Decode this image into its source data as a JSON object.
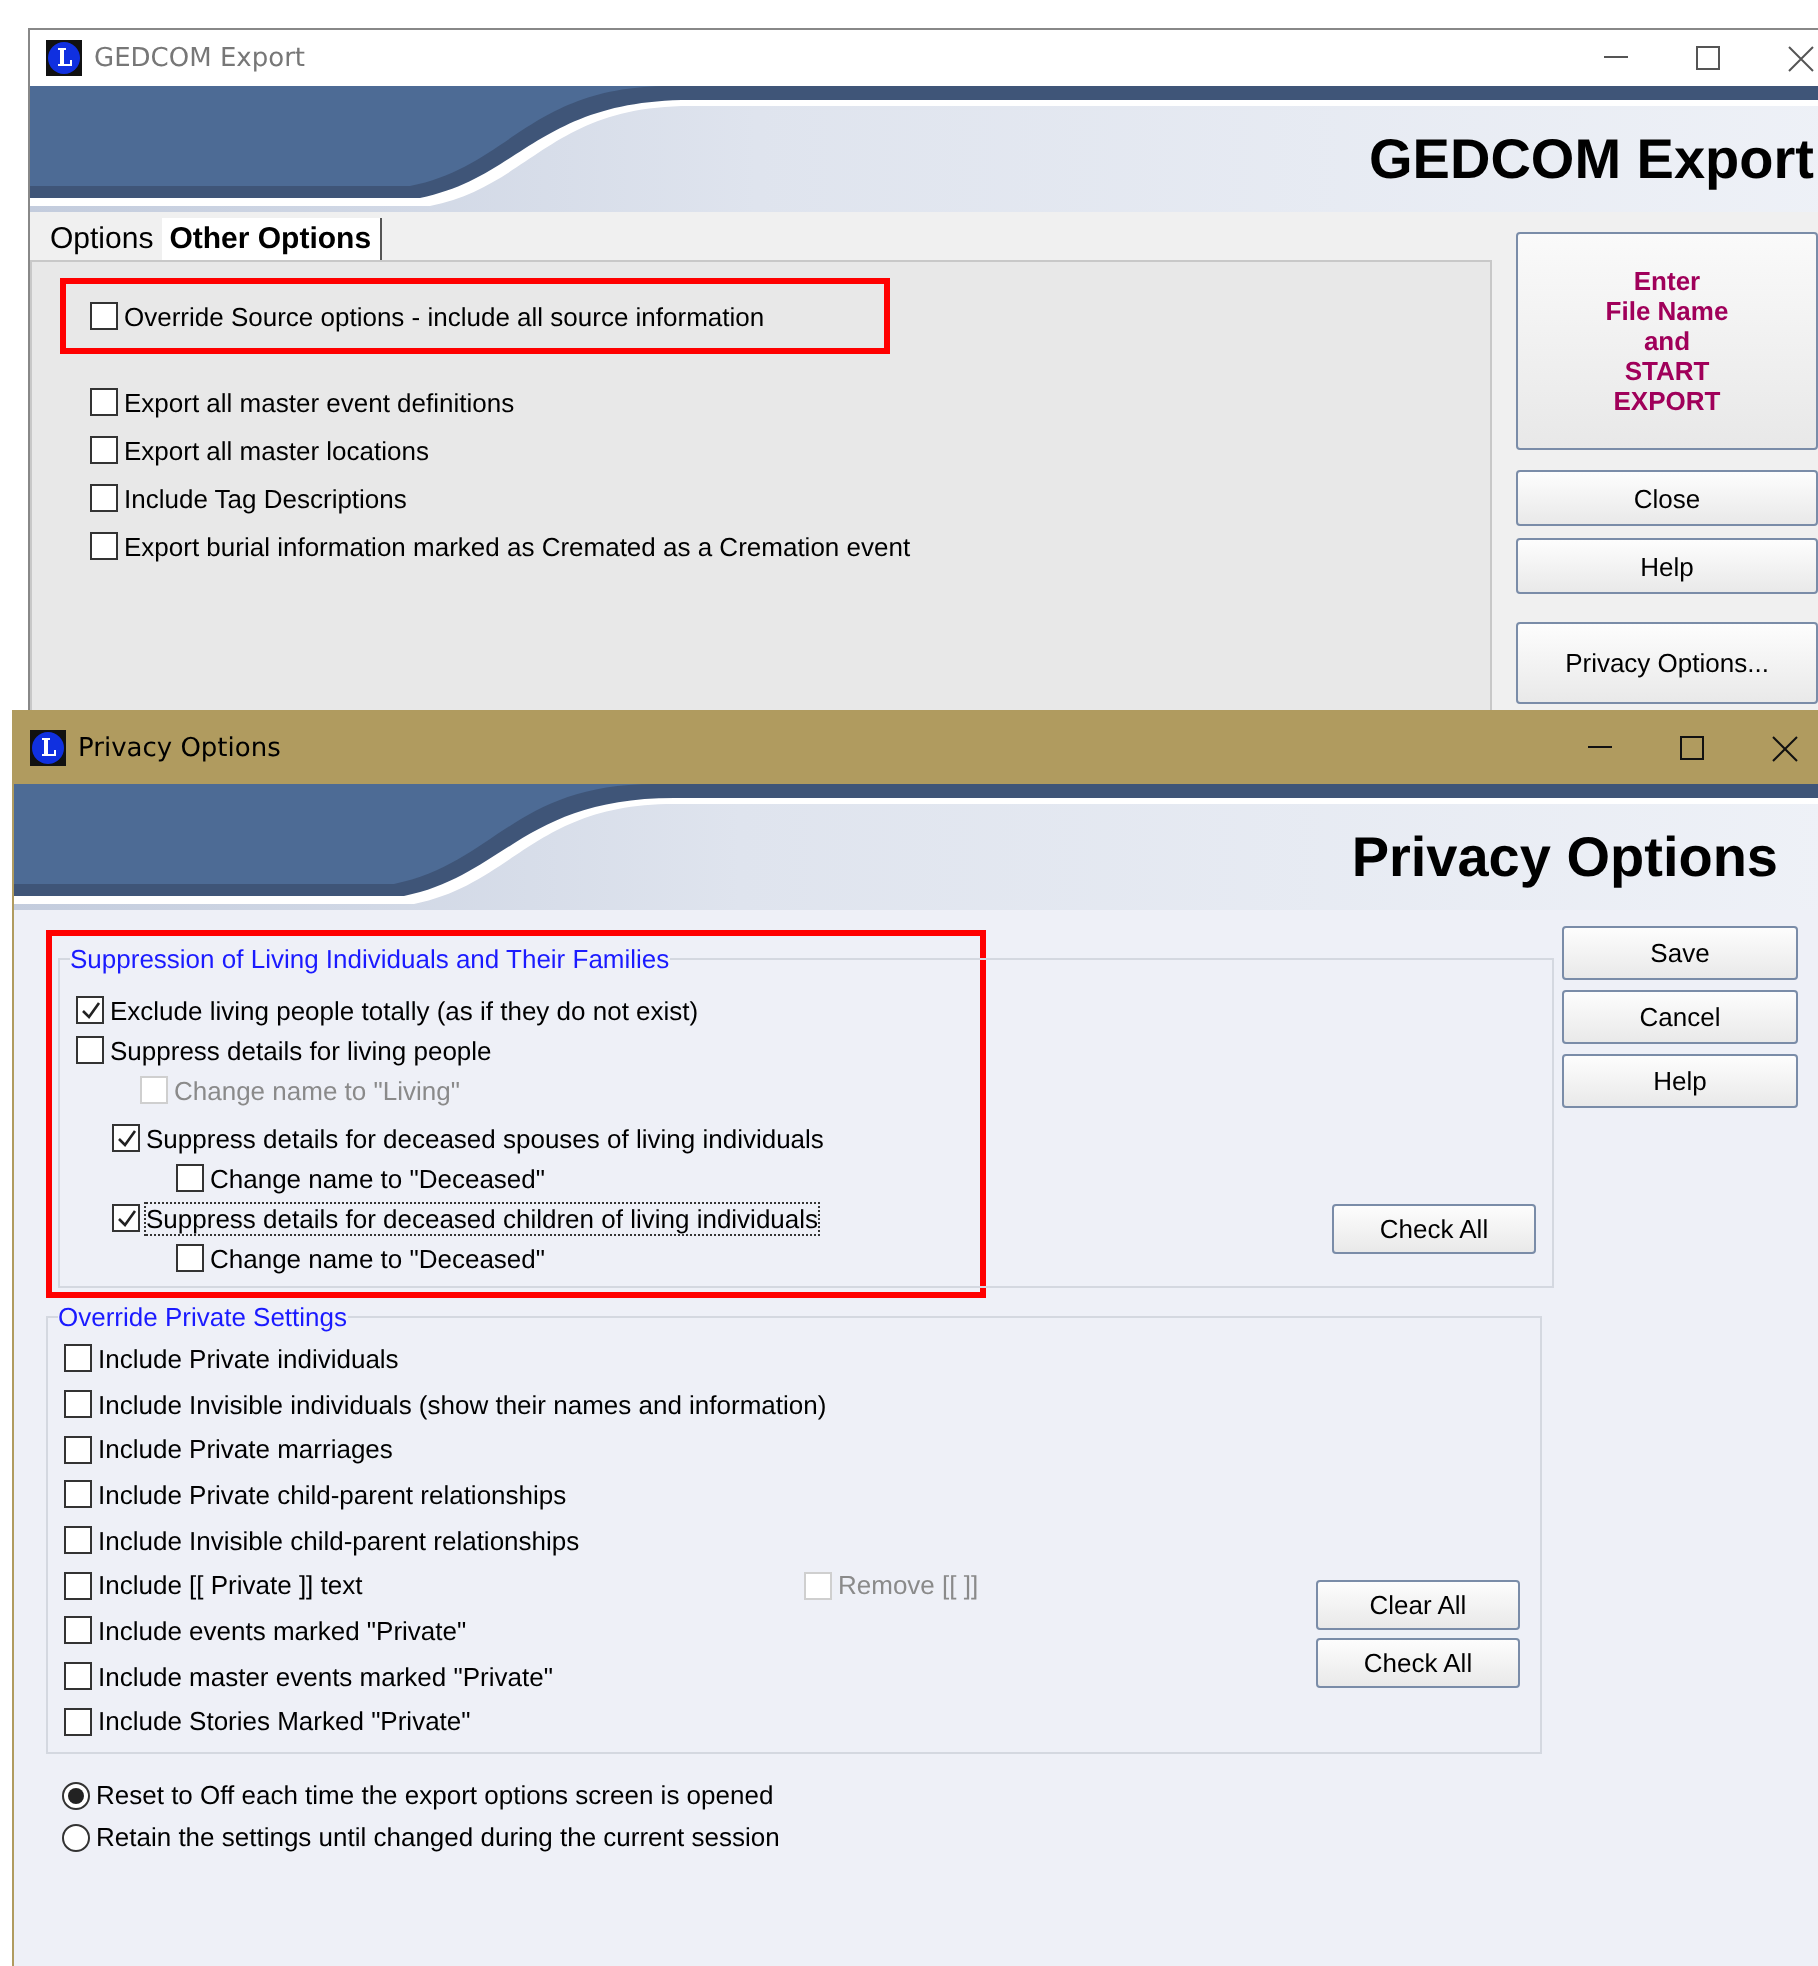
{
  "gedcom_window": {
    "title": "GEDCOM Export",
    "heading": "GEDCOM Export",
    "tabs": [
      {
        "label": "Options",
        "selected": false
      },
      {
        "label": "Other Options",
        "selected": true
      }
    ],
    "source_option": {
      "label": "Override Source options - include all source information",
      "checked": false,
      "highlighted": true
    },
    "options": [
      {
        "label": "Export all master event definitions",
        "checked": false
      },
      {
        "label": "Export all master locations",
        "checked": false
      },
      {
        "label": "Include Tag Descriptions",
        "checked": false
      },
      {
        "label": "Export burial information marked as Cremated as a Cremation event",
        "checked": false
      }
    ],
    "start_button": [
      "Enter",
      "File Name",
      "and",
      "START",
      "EXPORT"
    ],
    "buttons": [
      "Close",
      "Help"
    ],
    "privacy_button": "Privacy Options..."
  },
  "privacy_window": {
    "title": "Privacy Options",
    "heading": "Privacy Options",
    "suppression": {
      "legend": "Suppression of Living Individuals and Their Families",
      "highlighted": true,
      "living_options": [
        {
          "label": "Exclude living people totally (as if they do not exist)",
          "checked": true,
          "focused": false,
          "disabled": false
        },
        {
          "label": "Suppress details for living people",
          "checked": false,
          "focused": false,
          "disabled": false,
          "children": [
            {
              "label": "Change name to \"Living\"",
              "checked": false,
              "focused": false,
              "disabled": true
            }
          ]
        }
      ],
      "deceased_options": [
        {
          "label": "Suppress details for deceased spouses of living individuals",
          "checked": true,
          "focused": false,
          "disabled": false,
          "children": [
            {
              "label": "Change name to \"Deceased\"",
              "checked": false,
              "focused": false,
              "disabled": false
            }
          ]
        },
        {
          "label": "Suppress details for deceased children of living individuals",
          "checked": true,
          "focused": true,
          "disabled": false,
          "children": [
            {
              "label": "Change name to \"Deceased\"",
              "checked": false,
              "focused": false,
              "disabled": false
            }
          ]
        }
      ],
      "check_all": "Check All"
    },
    "override": {
      "legend": "Override Private Settings",
      "options": [
        {
          "label": "Include Private individuals",
          "checked": false
        },
        {
          "label": "Include Invisible individuals (show their names and information)",
          "checked": false
        },
        {
          "label": "Include Private marriages",
          "checked": false
        },
        {
          "label": "Include Private child-parent relationships",
          "checked": false
        },
        {
          "label": "Include Invisible child-parent relationships",
          "checked": false
        },
        {
          "label": "Include [[ Private ]] text",
          "checked": false,
          "extra": {
            "label": "Remove [[  ]]",
            "checked": false,
            "disabled": true
          }
        },
        {
          "label": "Include events marked \"Private\"",
          "checked": false
        },
        {
          "label": "Include master events marked \"Private\"",
          "checked": false
        },
        {
          "label": "Include Stories Marked \"Private\"",
          "checked": false
        }
      ],
      "clear_all": "Clear All",
      "check_all": "Check All"
    },
    "radios": [
      {
        "label": "Reset to Off each time the export options screen is opened",
        "selected": true
      },
      {
        "label": "Retain the settings until changed during the current session",
        "selected": false
      }
    ],
    "buttons": [
      "Save",
      "Cancel",
      "Help"
    ]
  }
}
